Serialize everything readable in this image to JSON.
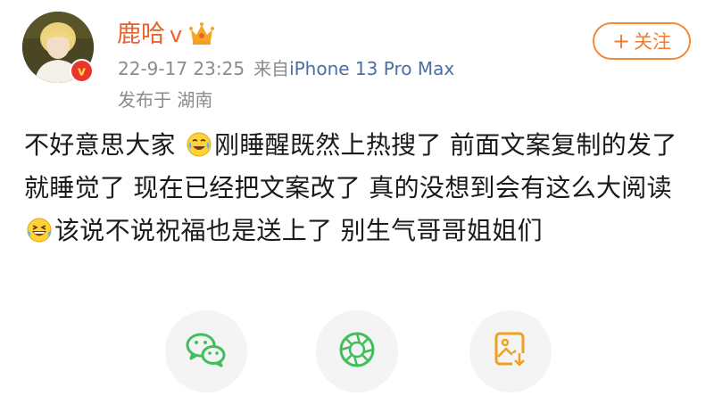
{
  "user": {
    "name": "鹿哈",
    "vip_mark": "v"
  },
  "meta": {
    "timestamp": "22-9-17 23:25",
    "source_prefix": "来自",
    "device": "iPhone 13 Pro Max",
    "location": "发布于 湖南"
  },
  "follow_button": {
    "plus": "+",
    "label": "关注"
  },
  "post": {
    "segment_1": "不好意思大家 ",
    "emoji_1": "tears-of-joy-emoji",
    "segment_2": "刚睡醒既然上热搜了 前面文案复制的发了就睡觉了 现在已经把文案改了 真的没想到会有这么大阅读",
    "emoji_2": "laughing-tears-emoji",
    "segment_3": "该说不说祝福也是送上了 别生气哥哥姐姐们"
  },
  "share": {
    "items": [
      "wechat-icon",
      "moments-icon",
      "save-image-icon"
    ]
  },
  "colors": {
    "username": "#e8622c",
    "follow": "#f07d2f",
    "device_link": "#4a6fa5",
    "meta": "#8b8b8b",
    "wechat": "#3fbf5b",
    "image_icon": "#f0a020"
  }
}
